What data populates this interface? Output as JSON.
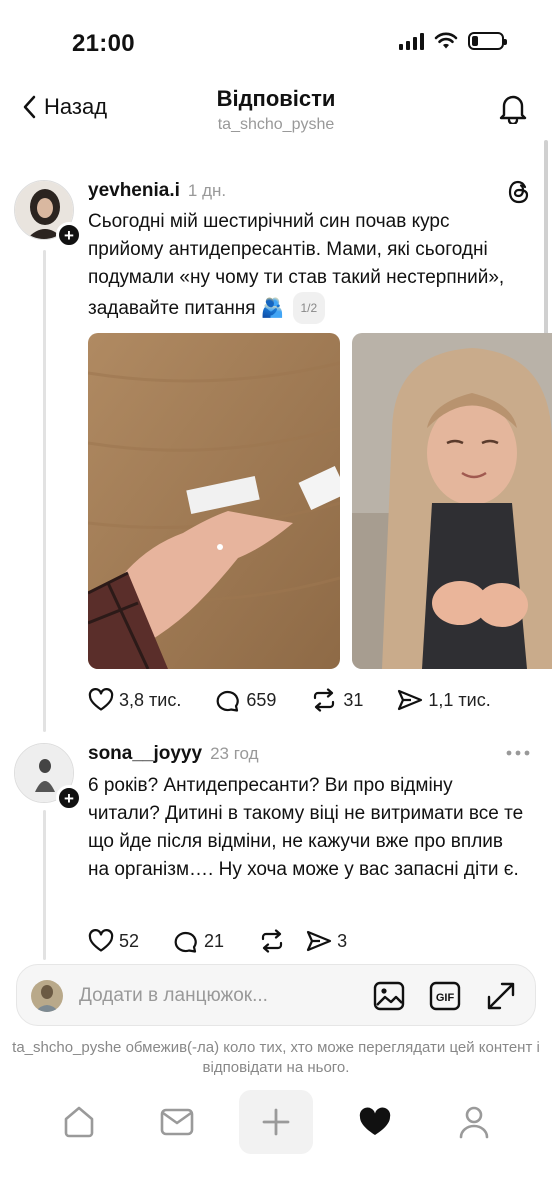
{
  "status_bar": {
    "time": "21:00"
  },
  "header": {
    "back_label": "Назад",
    "title": "Відповісти",
    "subtitle": "ta_shcho_pyshe"
  },
  "posts": [
    {
      "username": "yevhenia.i",
      "time": "1 дн.",
      "text": "Сьогодні мій шестирічний син почав курс прийому антидепресантів. Мами, які сьогодні подумали «ну чому ти став такий нестерпний», задавайте питання 🫂",
      "page_indicator": "1/2",
      "likes": "3,8 тис.",
      "replies": "659",
      "reposts": "31",
      "shares": "1,1 тис."
    },
    {
      "username": "sona__joyyy",
      "time": "23 год",
      "text": "6 років? Антидепресанти? Ви про відміну читали? Дитині в такому віці не витримати все те що йде після відміни, не кажучи вже про вплив на організм…. Ну хоча може у вас запасні діти є.",
      "likes": "52",
      "replies": "21",
      "shares": "3"
    }
  ],
  "composer": {
    "placeholder": "Додати в ланцюжок..."
  },
  "notice": "ta_shcho_pyshe обмежив(-ла) коло тих, хто може переглядати цей контент і відповідати на нього.",
  "colors": {
    "text": "#111111",
    "muted": "#999999",
    "thread_line": "#e2e2e2",
    "composer_bg": "#f6f6f6"
  },
  "icons": [
    "chevron-left-icon",
    "bell-icon",
    "threads-logo-icon",
    "more-icon",
    "heart-icon",
    "comment-icon",
    "repost-icon",
    "share-icon",
    "image-icon",
    "gif-icon",
    "expand-icon",
    "home-icon",
    "inbox-icon",
    "plus-icon",
    "heart-filled-icon",
    "profile-icon"
  ]
}
